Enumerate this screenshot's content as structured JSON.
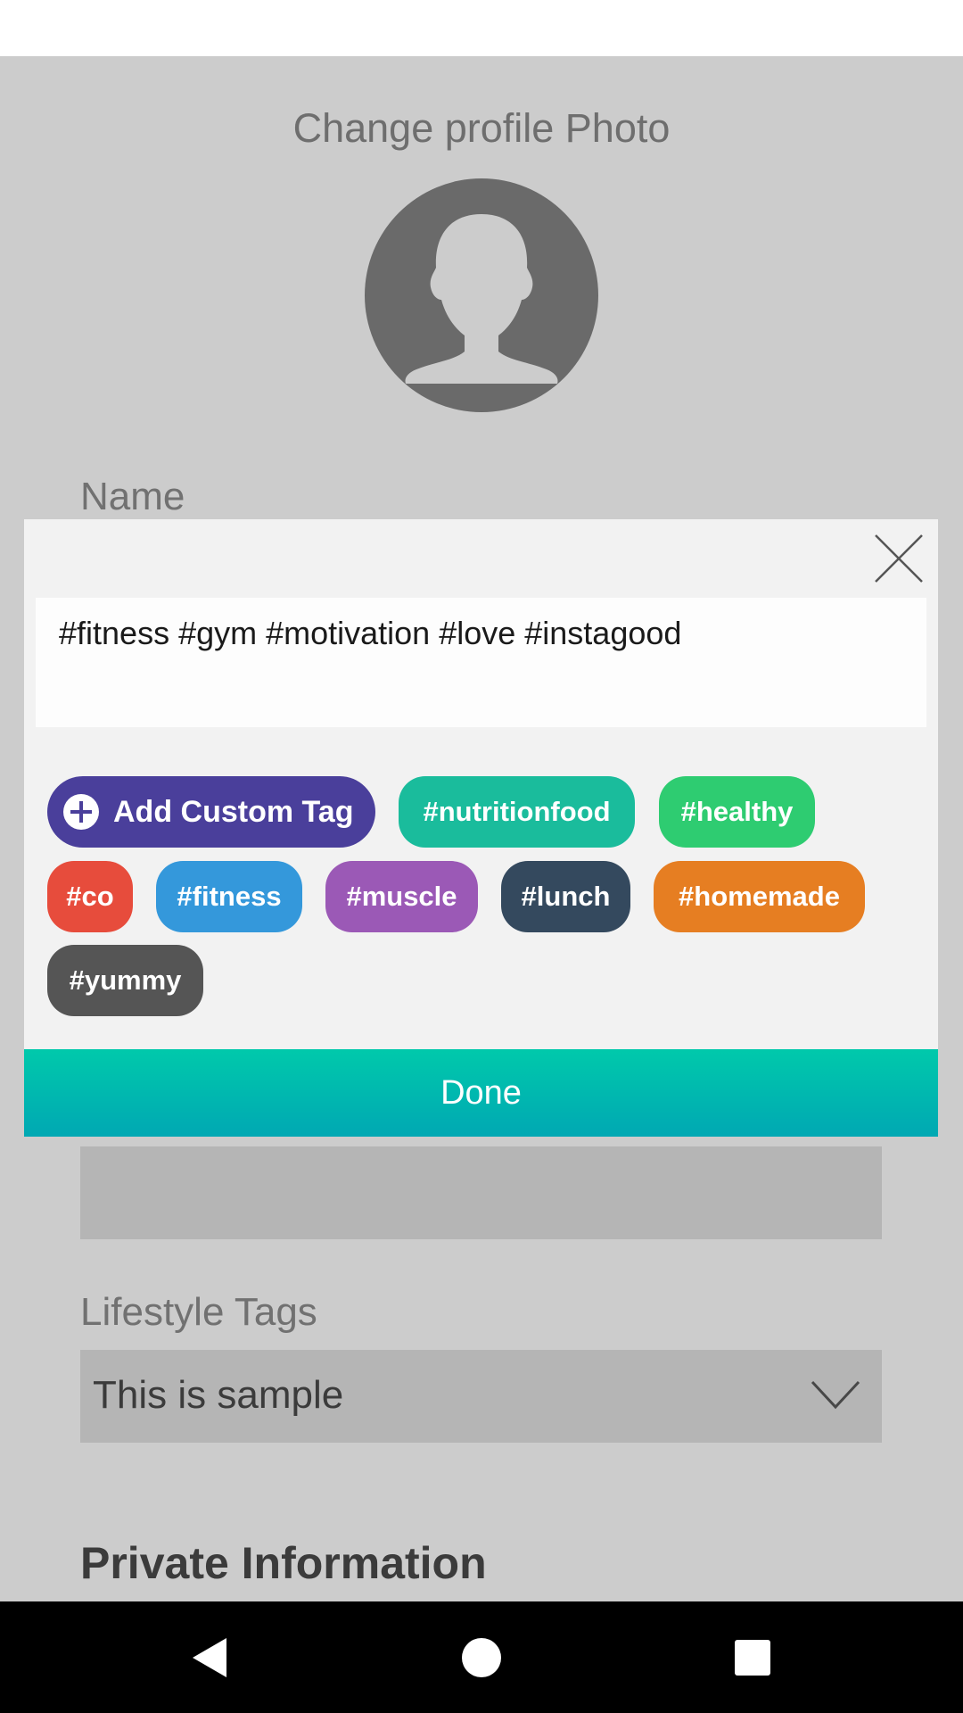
{
  "profile": {
    "change_photo_label": "Change profile Photo",
    "name_label": "Name",
    "lifestyle_label": "Lifestyle Tags",
    "lifestyle_value": "This is sample",
    "private_title": "Private Information"
  },
  "modal": {
    "input_value": "#fitness #gym #motivation #love #instagood",
    "add_custom_label": "Add Custom Tag",
    "done_label": "Done",
    "tags": [
      {
        "label": "#nutritionfood",
        "color": "#1abc9c"
      },
      {
        "label": "#healthy",
        "color": "#2ecc71"
      },
      {
        "label": "#co",
        "color": "#e74c3c"
      },
      {
        "label": "#fitness",
        "color": "#3498db"
      },
      {
        "label": "#muscle",
        "color": "#9b59b6"
      },
      {
        "label": "#lunch",
        "color": "#34495e"
      },
      {
        "label": "#homemade",
        "color": "#e67e22"
      },
      {
        "label": "#yummy",
        "color": "#555555"
      }
    ]
  },
  "colors": {
    "accent": "#4a3f9b",
    "done_gradient_top": "#00c9ab",
    "done_gradient_bottom": "#00a8b3"
  },
  "icons": {
    "close": "close-icon",
    "avatar": "person-silhouette-icon",
    "dropdown": "chevron-down-icon",
    "plus": "plus-circle-icon",
    "nav_back": "triangle-back-icon",
    "nav_home": "circle-home-icon",
    "nav_recent": "square-recent-icon"
  }
}
